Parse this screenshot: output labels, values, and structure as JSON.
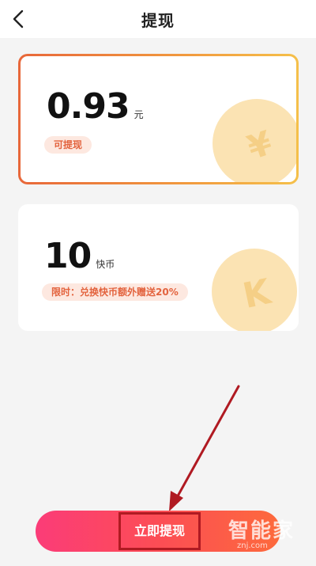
{
  "header": {
    "title": "提现"
  },
  "balance_card": {
    "amount": "0.93",
    "unit": "元",
    "badge": "可提现",
    "coin_glyph": "¥"
  },
  "coins_card": {
    "amount": "10",
    "unit": "快币",
    "badge": "限时：兑换快币额外赠送20%",
    "coin_glyph": "K"
  },
  "actions": {
    "withdraw_label": "立即提现"
  },
  "watermark": {
    "text": "智能家",
    "sub": "znj.com"
  },
  "colors": {
    "accent_start": "#fb3c78",
    "accent_end": "#fd6a3c",
    "annotation": "#b01a22",
    "badge_text": "#e3633e"
  }
}
